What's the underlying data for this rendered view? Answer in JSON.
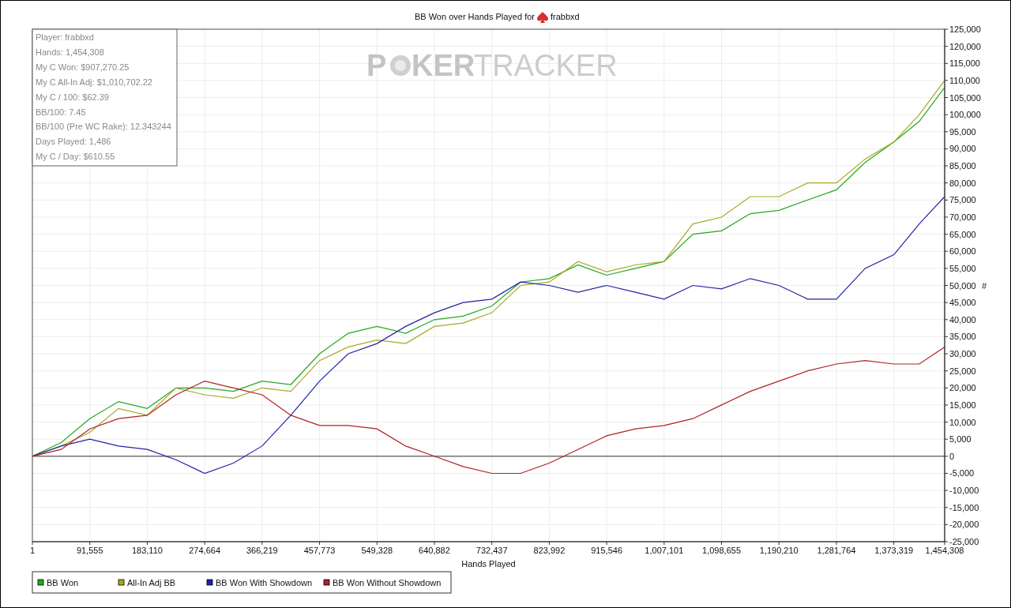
{
  "chart": {
    "title": "BB Won over Hands Played for",
    "player": "frabbxd",
    "watermark": {
      "lead": "P",
      "bold": "KER",
      "light": "TRACKER"
    },
    "stats": [
      "Player: frabbxd",
      "Hands: 1,454,308",
      "My C Won: $907,270.25",
      "My C All-In Adj: $1,010,702.22",
      "My C / 100: $62.39",
      "BB/100: 7.45",
      "BB/100 (Pre WC Rake): 12.343244",
      "Days Played: 1,486",
      "My C / Day: $610.55"
    ],
    "chart_data": {
      "type": "line",
      "xlabel": "Hands Played",
      "ylabel": "#",
      "xlim": [
        1,
        1454308
      ],
      "ylim": [
        -25000,
        125000
      ],
      "grid": true,
      "legend": true,
      "xticks": [
        {
          "value": 1,
          "label": "1"
        },
        {
          "value": 91555,
          "label": "91,555"
        },
        {
          "value": 183110,
          "label": "183,110"
        },
        {
          "value": 274664,
          "label": "274,664"
        },
        {
          "value": 366219,
          "label": "366,219"
        },
        {
          "value": 457773,
          "label": "457,773"
        },
        {
          "value": 549328,
          "label": "549,328"
        },
        {
          "value": 640882,
          "label": "640,882"
        },
        {
          "value": 732437,
          "label": "732,437"
        },
        {
          "value": 823992,
          "label": "823,992"
        },
        {
          "value": 915546,
          "label": "915,546"
        },
        {
          "value": 1007101,
          "label": "1,007,101"
        },
        {
          "value": 1098655,
          "label": "1,098,655"
        },
        {
          "value": 1190210,
          "label": "1,190,210"
        },
        {
          "value": 1281764,
          "label": "1,281,764"
        },
        {
          "value": 1373319,
          "label": "1,373,319"
        },
        {
          "value": 1454308,
          "label": "1,454,308"
        }
      ],
      "yticks": [
        {
          "value": -25000,
          "label": "-25,000"
        },
        {
          "value": -20000,
          "label": "-20,000"
        },
        {
          "value": -15000,
          "label": "-15,000"
        },
        {
          "value": -10000,
          "label": "-10,000"
        },
        {
          "value": -5000,
          "label": "-5,000"
        },
        {
          "value": 0,
          "label": "0"
        },
        {
          "value": 5000,
          "label": "5,000"
        },
        {
          "value": 10000,
          "label": "10,000"
        },
        {
          "value": 15000,
          "label": "15,000"
        },
        {
          "value": 20000,
          "label": "20,000"
        },
        {
          "value": 25000,
          "label": "25,000"
        },
        {
          "value": 30000,
          "label": "30,000"
        },
        {
          "value": 35000,
          "label": "35,000"
        },
        {
          "value": 40000,
          "label": "40,000"
        },
        {
          "value": 45000,
          "label": "45,000"
        },
        {
          "value": 50000,
          "label": "50,000"
        },
        {
          "value": 55000,
          "label": "55,000"
        },
        {
          "value": 60000,
          "label": "60,000"
        },
        {
          "value": 65000,
          "label": "65,000"
        },
        {
          "value": 70000,
          "label": "70,000"
        },
        {
          "value": 75000,
          "label": "75,000"
        },
        {
          "value": 80000,
          "label": "80,000"
        },
        {
          "value": 85000,
          "label": "85,000"
        },
        {
          "value": 90000,
          "label": "90,000"
        },
        {
          "value": 95000,
          "label": "95,000"
        },
        {
          "value": 100000,
          "label": "100,000"
        },
        {
          "value": 105000,
          "label": "105,000"
        },
        {
          "value": 110000,
          "label": "110,000"
        },
        {
          "value": 115000,
          "label": "115,000"
        },
        {
          "value": 120000,
          "label": "120,000"
        },
        {
          "value": 125000,
          "label": "125,000"
        }
      ],
      "x": [
        1,
        45778,
        91555,
        137332,
        183110,
        228887,
        274664,
        320441,
        366219,
        411996,
        457773,
        503550,
        549328,
        595105,
        640882,
        686659,
        732437,
        778214,
        823992,
        869769,
        915546,
        961323,
        1007101,
        1052878,
        1098655,
        1144432,
        1190210,
        1235987,
        1281764,
        1327541,
        1373319,
        1413813,
        1454308
      ],
      "series": [
        {
          "name": "BB Won",
          "color": "#22a822",
          "values": [
            0,
            4000,
            11000,
            16000,
            14000,
            20000,
            20000,
            19000,
            22000,
            21000,
            30000,
            36000,
            38000,
            36000,
            40000,
            41000,
            44000,
            51000,
            52000,
            56000,
            53000,
            55000,
            57000,
            65000,
            66000,
            71000,
            72000,
            75000,
            78000,
            86000,
            92000,
            98000,
            108000
          ]
        },
        {
          "name": "All-In Adj BB",
          "color": "#a8a820",
          "values": [
            0,
            3000,
            7000,
            14000,
            12000,
            20000,
            18000,
            17000,
            20000,
            19000,
            28000,
            32000,
            34000,
            33000,
            38000,
            39000,
            42000,
            50000,
            51000,
            57000,
            54000,
            56000,
            57000,
            68000,
            70000,
            76000,
            76000,
            80000,
            80000,
            87000,
            92000,
            100000,
            110000
          ]
        },
        {
          "name": "BB Won With Showdown",
          "color": "#2222a8",
          "values": [
            0,
            3000,
            5000,
            3000,
            2000,
            -1000,
            -5000,
            -2000,
            3000,
            12000,
            22000,
            30000,
            33000,
            38000,
            42000,
            45000,
            46000,
            51000,
            50000,
            48000,
            50000,
            48000,
            46000,
            50000,
            49000,
            52000,
            50000,
            46000,
            46000,
            55000,
            59000,
            68000,
            76000
          ]
        },
        {
          "name": "BB Won Without Showdown",
          "color": "#b02222",
          "values": [
            0,
            2000,
            8000,
            11000,
            12000,
            18000,
            22000,
            20000,
            18000,
            12000,
            9000,
            9000,
            8000,
            3000,
            0,
            -3000,
            -5000,
            -5000,
            -2000,
            2000,
            6000,
            8000,
            9000,
            11000,
            15000,
            19000,
            22000,
            25000,
            27000,
            28000,
            27000,
            27000,
            32000
          ]
        }
      ]
    }
  }
}
